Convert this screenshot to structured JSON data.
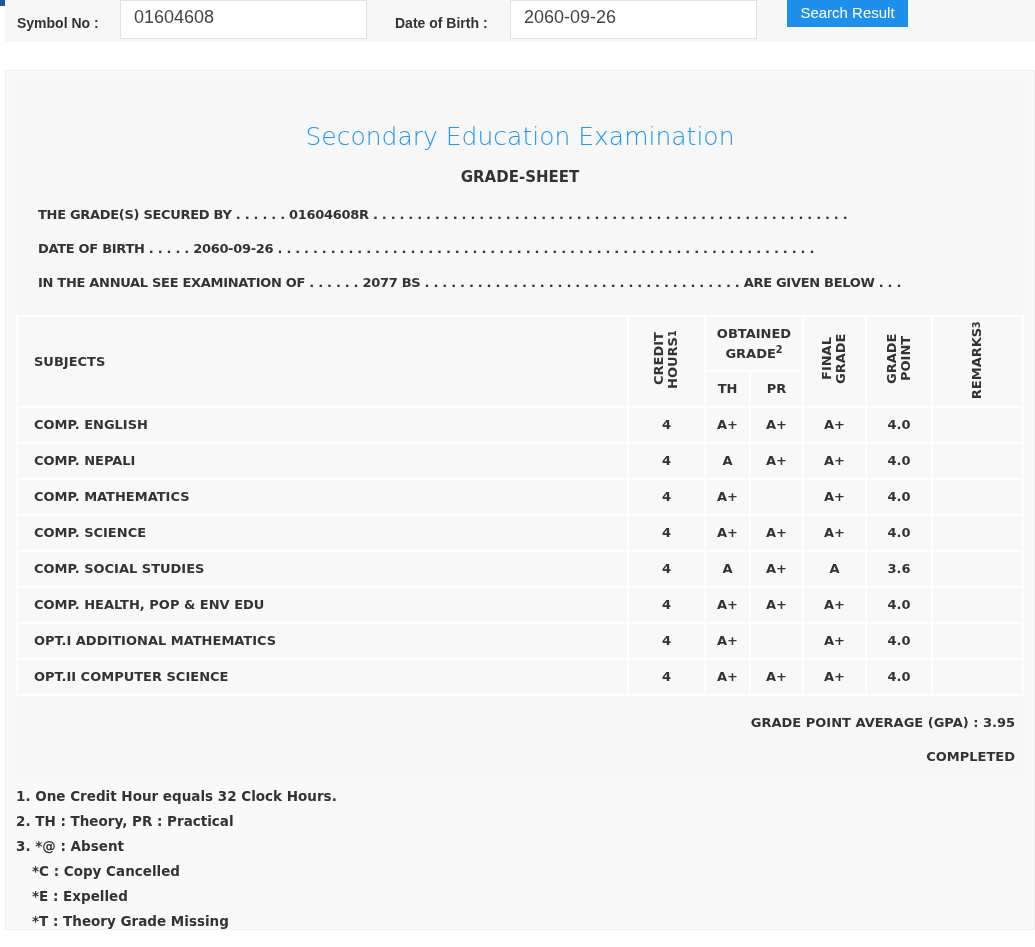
{
  "search_form": {
    "symbol_label": "Symbol No :",
    "symbol_value": "01604608",
    "dob_label": "Date of Birth :",
    "dob_value": "2060-09-26",
    "button": "Search Result"
  },
  "grade_sheet": {
    "title": "Secondary Education Examination",
    "subtitle": "GRADE-SHEET",
    "statements": [
      "THE GRADE(S) SECURED BY . . . . . . 01604608R . . . . . . . . . . . . . . . . . . . . . . . . . . . . . . . . . . . . . . . . . . . . . . . . . . . . . .",
      "DATE OF BIRTH . . . . . 2060-09-26 . . . . . . . . . . . . . . . . . . . . . . . . . . . . . . . . . . . . . . . . . . . . . . . . . . . . . . . . . . . . .",
      "IN THE ANNUAL SEE EXAMINATION OF . . . . . . 2077 BS . . . . . . . . . . . . . . . . . . . . . . . . . . . . . . . . . . . . ARE GIVEN BELOW . . ."
    ]
  },
  "table": {
    "columns": {
      "subjects": "SUBJECTS",
      "credit_hours": "CREDIT HOURS$^{1}$",
      "obtained_grade": "OBTAINED GRADE$^{2}$",
      "th": "TH",
      "pr": "PR",
      "final_grade": "FINAL GRADE",
      "grade_point": "GRADE POINT",
      "remarks": "REMARKS$^{3}$"
    },
    "rows": [
      {
        "subject": "COMP. ENGLISH",
        "credit_hours": "4",
        "th": "A+",
        "pr": "A+",
        "final_grade": "A+",
        "grade_point": "4.0"
      },
      {
        "subject": "COMP. NEPALI",
        "credit_hours": "4",
        "th": "A",
        "pr": "A+",
        "final_grade": "A+",
        "grade_point": "4.0"
      },
      {
        "subject": "COMP. MATHEMATICS",
        "credit_hours": "4",
        "th": "A+",
        "final_grade": "A+",
        "grade_point": "4.0"
      },
      {
        "subject": "COMP. SCIENCE",
        "credit_hours": "4",
        "th": "A+",
        "pr": "A+",
        "final_grade": "A+",
        "grade_point": "4.0"
      },
      {
        "subject": "COMP. SOCIAL STUDIES",
        "credit_hours": "4",
        "th": "A",
        "pr": "A+",
        "final_grade": "A",
        "grade_point": "3.6"
      },
      {
        "subject": "COMP. HEALTH, POP & ENV EDU",
        "credit_hours": "4",
        "th": "A+",
        "pr": "A+",
        "final_grade": "A+",
        "grade_point": "4.0"
      },
      {
        "subject": "OPT.I ADDITIONAL MATHEMATICS",
        "credit_hours": "4",
        "th": "A+",
        "final_grade": "A+",
        "grade_point": "4.0"
      },
      {
        "subject": "OPT.II COMPUTER SCIENCE",
        "credit_hours": "4",
        "th": "A+",
        "pr": "A+",
        "final_grade": "A+",
        "grade_point": "4.0"
      }
    ]
  },
  "summary": {
    "gpa": "GRADE POINT AVERAGE (GPA) : 3.95",
    "status": "COMPLETED"
  },
  "footnotes": [
    "1. One Credit Hour equals 32 Clock Hours.",
    "2. TH : Theory, PR : Practical",
    "3. *@ : Absent",
    "*C : Copy Cancelled",
    "*E : Expelled",
    "*T : Theory Grade Missing"
  ]
}
